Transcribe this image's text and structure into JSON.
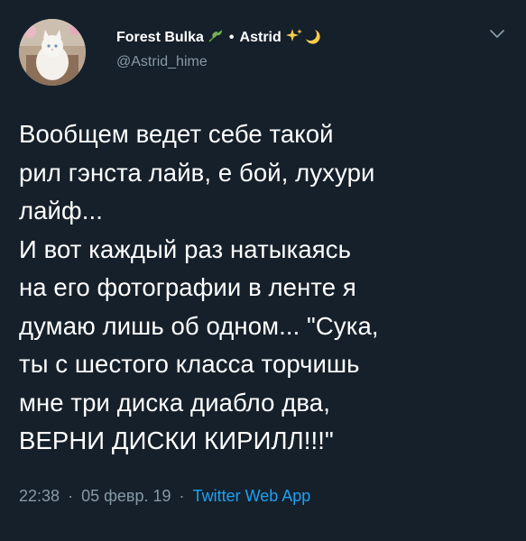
{
  "author": {
    "display_name": "Forest Bulka",
    "separator": "•",
    "display_name_2": "Astrid",
    "handle": "@Astrid_hime",
    "name_emojis": [
      "leaf-icon",
      "sparkle-icon",
      "moon-icon"
    ]
  },
  "tweet": {
    "text": "Вообщем ведет себе такой\nрил гэнста лайв, е бой, лухури\nлайф...\nИ вот каждый раз натыкаясь\nна его фотографии в ленте я\nдумаю лишь об одном... \"Сука,\nты с шестого класса торчишь\nмне три диска диабло два,\nВЕРНИ ДИСКИ КИРИЛЛ!!!\"",
    "time": "22:38",
    "dot": "·",
    "date": "05 февр. 19",
    "source": "Twitter Web App"
  },
  "colors": {
    "background": "#15202b",
    "text": "#ffffff",
    "muted": "#8899a6",
    "accent": "#1da1f2"
  }
}
